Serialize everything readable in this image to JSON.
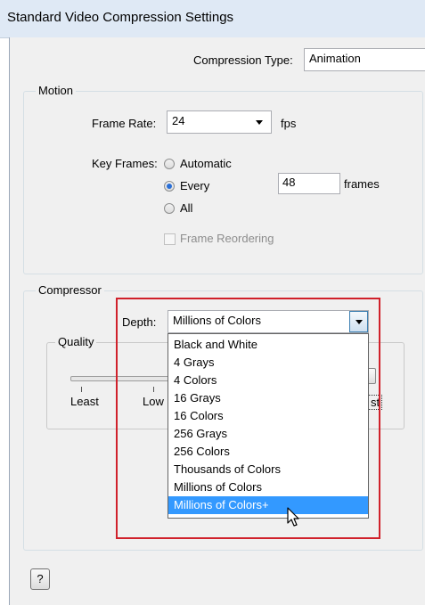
{
  "window": {
    "title": "Standard Video Compression Settings"
  },
  "compression": {
    "label": "Compression Type:",
    "value": "Animation"
  },
  "motion": {
    "legend": "Motion",
    "frame_rate_label": "Frame Rate:",
    "frame_rate_value": "24",
    "fps_label": "fps",
    "key_frames_label": "Key Frames:",
    "options": [
      "Automatic",
      "Every",
      "All"
    ],
    "selected_option": "Every",
    "every_value": "48",
    "frames_label": "frames",
    "reorder_label": "Frame Reordering"
  },
  "compressor": {
    "legend": "Compressor",
    "depth_label": "Depth:",
    "depth_value": "Millions of Colors",
    "depth_options": [
      "Black and White",
      "4 Grays",
      "4 Colors",
      "16 Grays",
      "16 Colors",
      "256 Grays",
      "256 Colors",
      "Thousands of Colors",
      "Millions of Colors",
      "Millions of Colors+"
    ],
    "highlighted_option": "Millions of Colors+",
    "quality_legend": "Quality",
    "quality_ticks": [
      "Least",
      "Low",
      "st"
    ]
  },
  "help": {
    "label": "?"
  },
  "colors": {
    "highlight": "#3399ff",
    "annotation_box": "#d0212b",
    "dialog_bg": "#f0f0f0"
  },
  "icons": [
    "dropdown-arrow-icon",
    "mouse-cursor-icon"
  ]
}
